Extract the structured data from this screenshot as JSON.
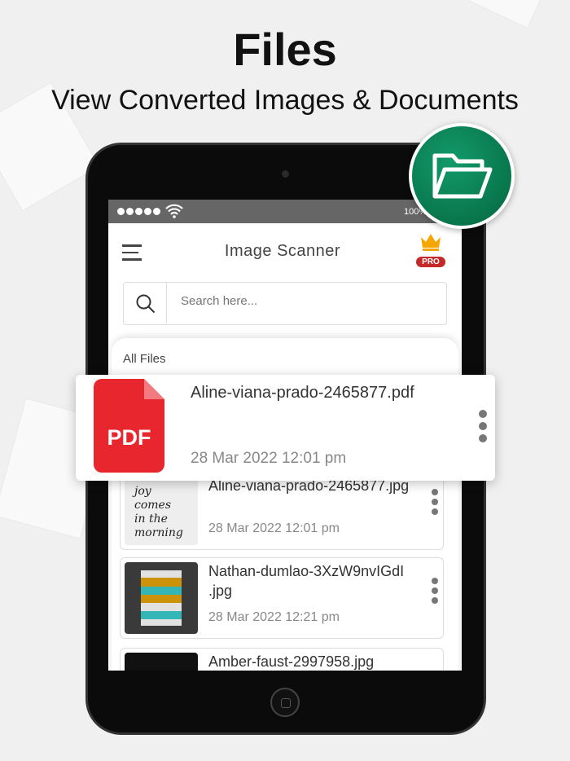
{
  "headline": "Files",
  "subheadline": "View Converted Images & Documents",
  "status": {
    "battery": "100%"
  },
  "header": {
    "title": "Image Scanner",
    "pro_badge": "PRO"
  },
  "search": {
    "placeholder": "Search here..."
  },
  "section_title": "All Files",
  "highlighted_file": {
    "name": "Aline-viana-prado-2465877.pdf",
    "date": "28 Mar 2022 12:01 pm",
    "icon_label": "PDF"
  },
  "files": [
    {
      "name": "Aline-viana-prado-2465877.jpg",
      "date": "28 Mar 2022 12:01 pm"
    },
    {
      "name": "Nathan-dumlao-3XzW9nvIGdI .jpg",
      "date": "28 Mar 2022 12:21 pm"
    },
    {
      "name": "Amber-faust-2997958.jpg",
      "date": ""
    }
  ],
  "colors": {
    "accent": "#0a7a52",
    "pdf_red": "#e8262e",
    "pro_red": "#c62828",
    "crown": "#f5a600"
  }
}
